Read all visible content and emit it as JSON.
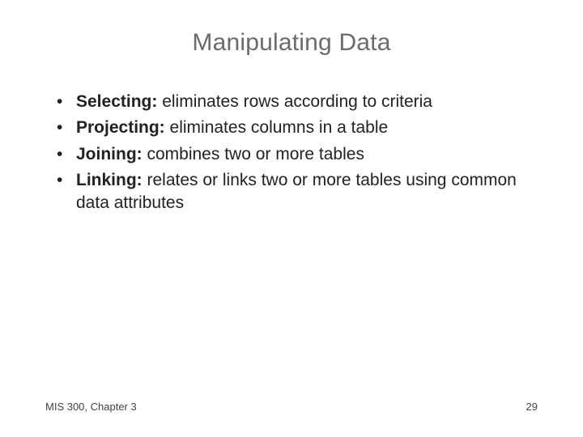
{
  "title": "Manipulating Data",
  "bullets": [
    {
      "term": "Selecting:",
      "desc": " eliminates rows according to criteria"
    },
    {
      "term": "Projecting:",
      "desc": " eliminates columns in a table"
    },
    {
      "term": "Joining:",
      "desc": " combines two or more tables"
    },
    {
      "term": "Linking:",
      "desc": " relates or links two or more tables using common data attributes"
    }
  ],
  "footer": {
    "left": "MIS 300, Chapter 3",
    "right": "29"
  }
}
